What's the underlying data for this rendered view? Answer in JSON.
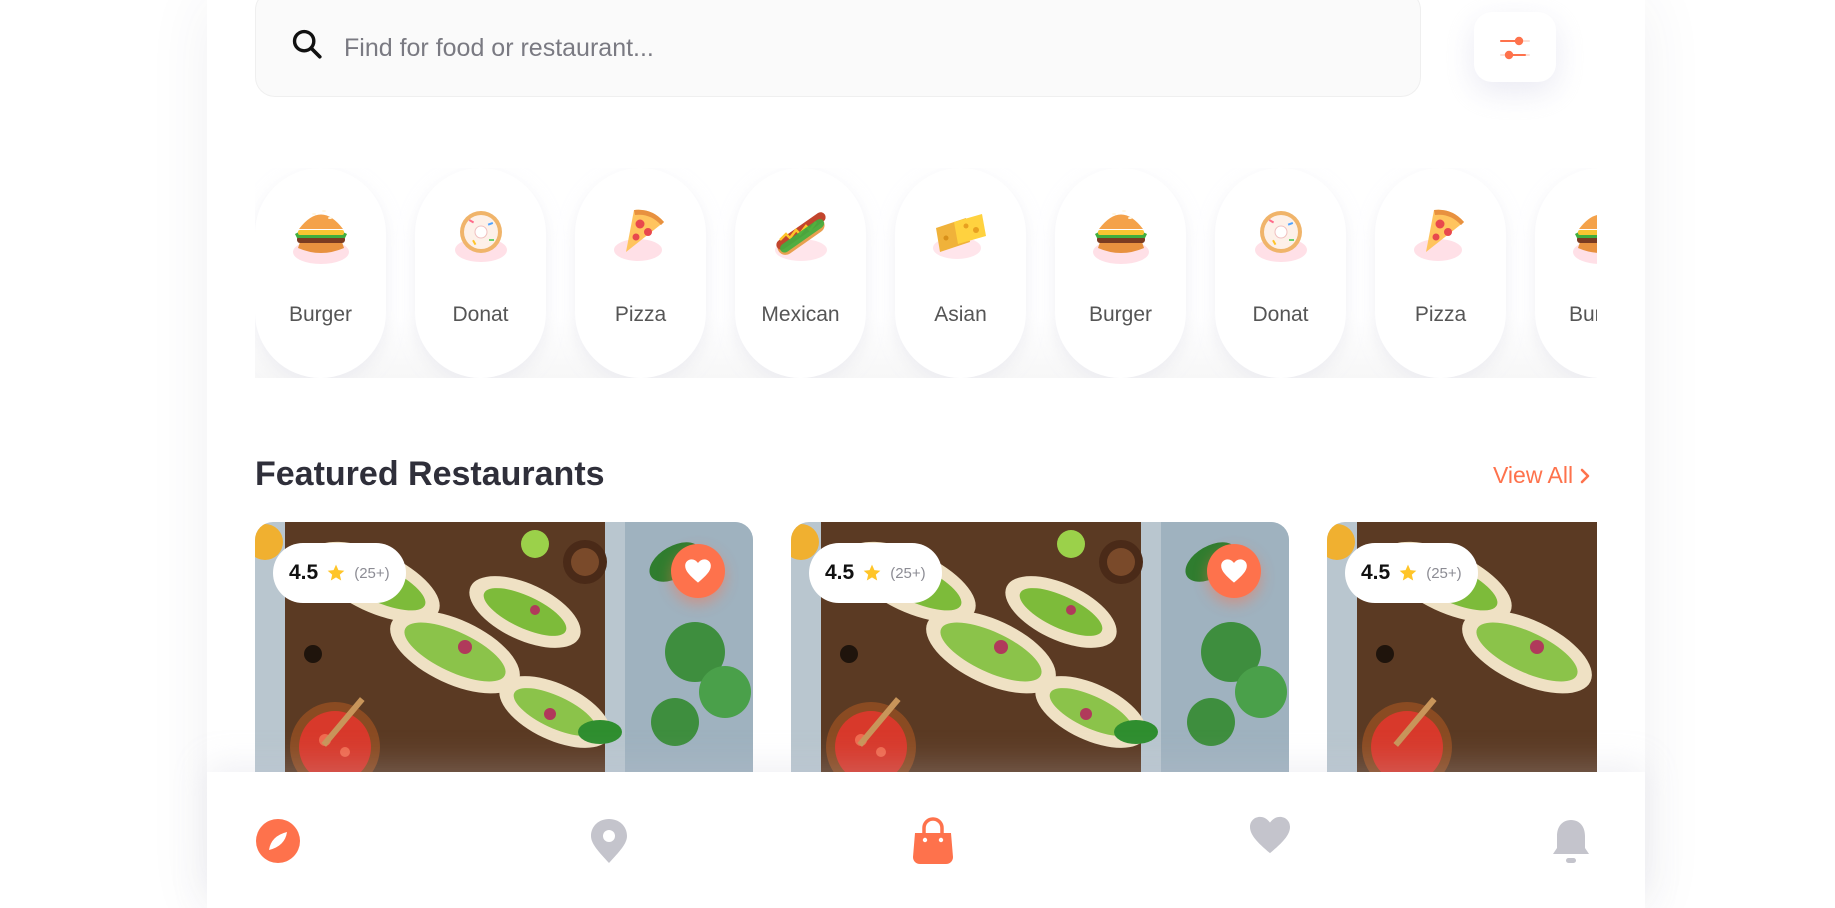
{
  "search": {
    "placeholder": "Find for food or restaurant..."
  },
  "icons": {
    "search": "search-icon",
    "filter": "filter-sliders-icon",
    "star": "star-icon",
    "heart": "heart-icon",
    "chevron": "chevron-right-icon"
  },
  "categories": [
    {
      "label": "Burger",
      "icon": "burger-icon"
    },
    {
      "label": "Donat",
      "icon": "donut-icon"
    },
    {
      "label": "Pizza",
      "icon": "pizza-icon"
    },
    {
      "label": "Mexican",
      "icon": "hotdog-icon"
    },
    {
      "label": "Asian",
      "icon": "cheese-icon"
    },
    {
      "label": "Burger",
      "icon": "burger-icon"
    },
    {
      "label": "Donat",
      "icon": "donut-icon"
    },
    {
      "label": "Pizza",
      "icon": "pizza-icon"
    },
    {
      "label": "Burger",
      "icon": "burger-icon"
    }
  ],
  "featured": {
    "title": "Featured Restaurants",
    "view_all": "View All",
    "cards": [
      {
        "rating": "4.5",
        "count": "(25+)",
        "favorite": true
      },
      {
        "rating": "4.5",
        "count": "(25+)",
        "favorite": true
      },
      {
        "rating": "4.5",
        "count": "(25+)",
        "favorite": false
      }
    ]
  },
  "nav": [
    {
      "icon": "compass-icon",
      "active": true
    },
    {
      "icon": "location-pin-icon",
      "active": false
    },
    {
      "icon": "shopping-bag-icon",
      "active": true
    },
    {
      "icon": "heart-icon",
      "active": false
    },
    {
      "icon": "bell-icon",
      "active": false
    }
  ],
  "colors": {
    "accent": "#fe724c",
    "star": "#ffc529",
    "inactive": "#c4c4cc"
  }
}
